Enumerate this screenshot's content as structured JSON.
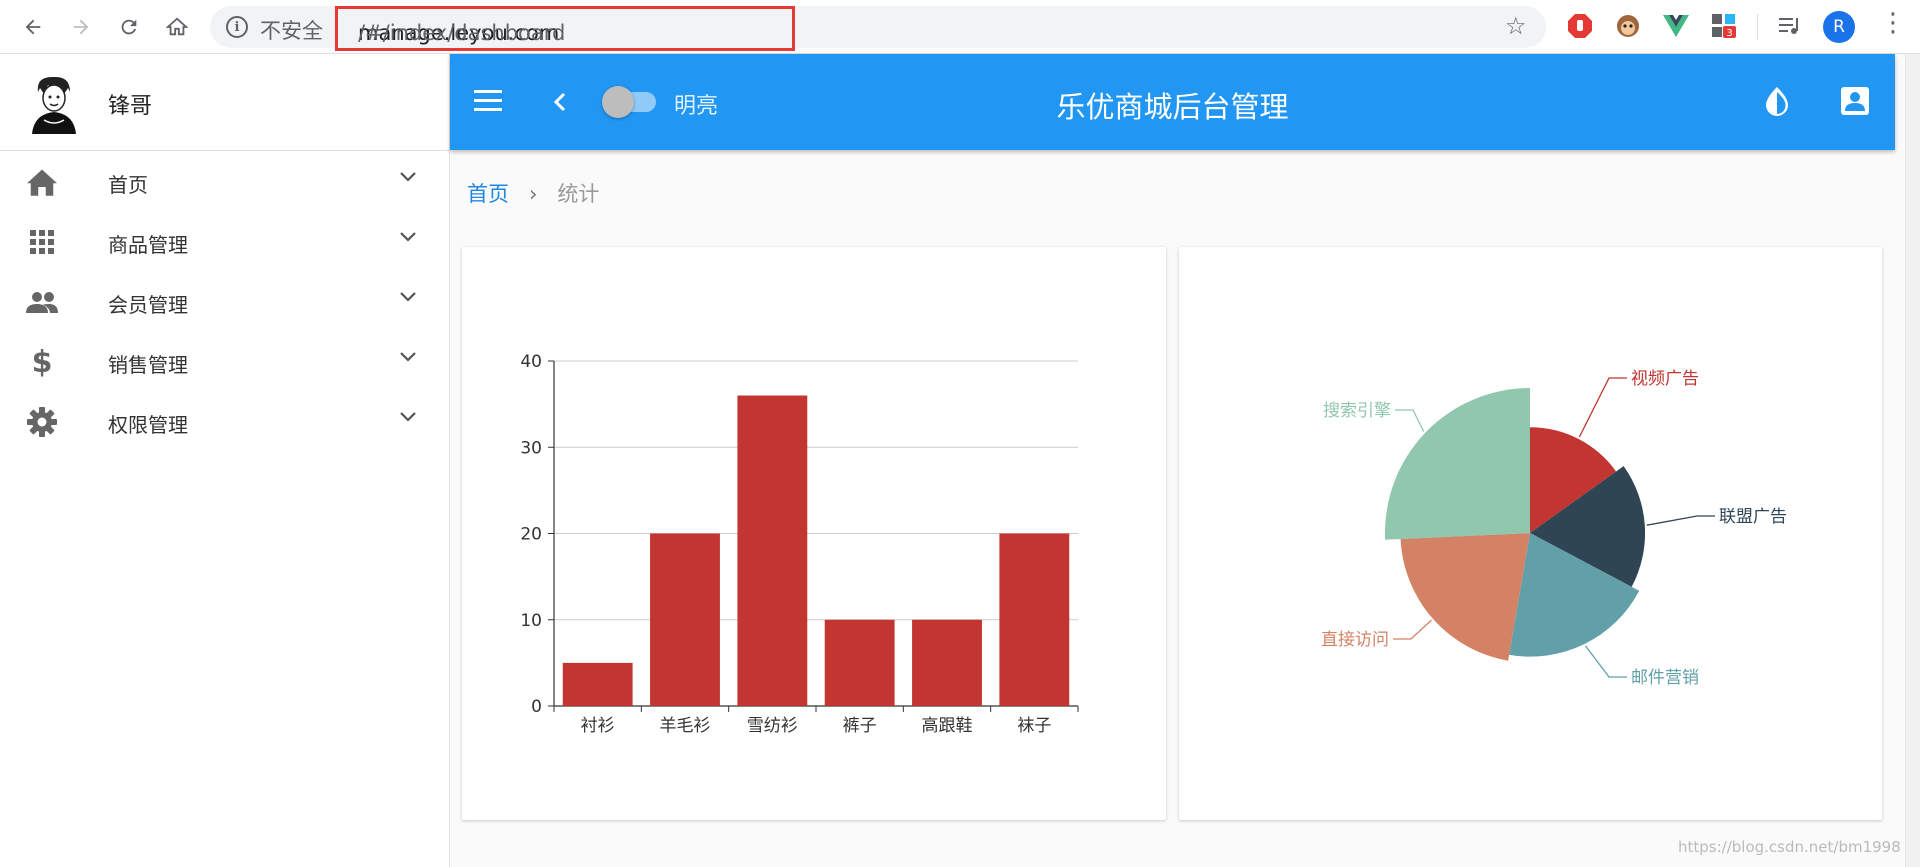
{
  "browser": {
    "insecure_label": "不安全",
    "url_host": "manage.leyou.com",
    "url_path": "/#/index/dashboard",
    "extension_badge": "3",
    "profile_letter": "R"
  },
  "sidebar": {
    "user_name": "锋哥",
    "items": [
      {
        "label": "首页",
        "icon": "home-icon"
      },
      {
        "label": "商品管理",
        "icon": "apps-grid-icon"
      },
      {
        "label": "会员管理",
        "icon": "people-icon"
      },
      {
        "label": "销售管理",
        "icon": "dollar-icon"
      },
      {
        "label": "权限管理",
        "icon": "gear-icon"
      }
    ]
  },
  "header": {
    "title": "乐优商城后台管理",
    "theme_label": "明亮",
    "accent_color": "#2196f3"
  },
  "breadcrumb": {
    "home": "首页",
    "separator": "›",
    "current": "统计"
  },
  "chart_data": [
    {
      "type": "bar",
      "categories": [
        "衬衫",
        "羊毛衫",
        "雪纺衫",
        "裤子",
        "高跟鞋",
        "袜子"
      ],
      "values": [
        5,
        20,
        36,
        10,
        10,
        20
      ],
      "ylim": [
        0,
        40
      ],
      "yticks": [
        0,
        10,
        20,
        30,
        40
      ],
      "grid": true,
      "color": "#c23531"
    },
    {
      "type": "pie",
      "rose": true,
      "slices": [
        {
          "name": "视频广告",
          "value": 235,
          "color": "#c23531"
        },
        {
          "name": "联盟广告",
          "value": 274,
          "color": "#2f4554"
        },
        {
          "name": "邮件营销",
          "value": 310,
          "color": "#61a0a8"
        },
        {
          "name": "直接访问",
          "value": 335,
          "color": "#d48265"
        },
        {
          "name": "搜索引擎",
          "value": 400,
          "color": "#91c7ae"
        }
      ]
    }
  ],
  "watermark": "https://blog.csdn.net/bm1998"
}
